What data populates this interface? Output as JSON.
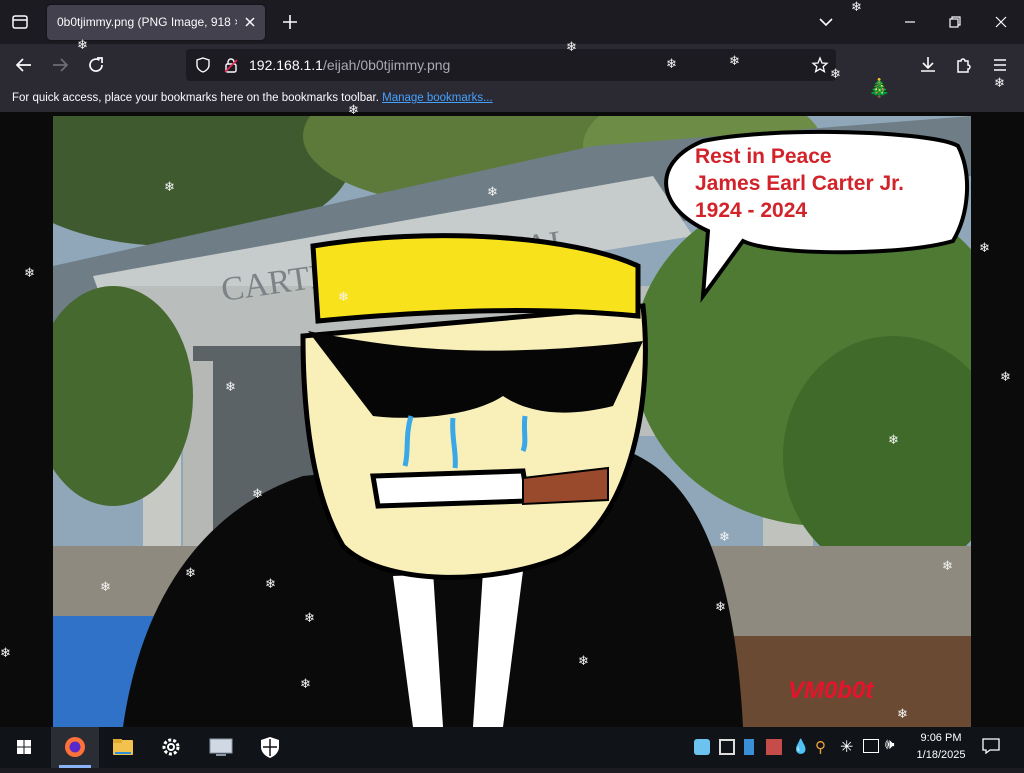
{
  "browser": {
    "tab_title": "0b0tjimmy.png (PNG Image, 918 ×",
    "url_host": "192.168.1.1",
    "url_path": "/eijah/0b0tjimmy.png",
    "bookmarks_message": "For quick access, place your bookmarks here on the bookmarks toolbar.",
    "bookmarks_link": "Manage bookmarks...",
    "icons": [
      "tab-list-icon",
      "new-tab-icon",
      "list-all-tabs-icon",
      "minimize-icon",
      "maximize-icon",
      "close-icon",
      "back-icon",
      "forward-icon",
      "reload-icon",
      "shield-icon",
      "lock-icon",
      "star-icon",
      "download-icon",
      "extensions-icon",
      "menu-icon"
    ]
  },
  "image": {
    "speech_line1": "Rest in Peace",
    "speech_line2": "James Earl Carter Jr.",
    "speech_line3": "1924 - 2024",
    "building_sign": "CARTER CENTENTIAL",
    "signature": "VM0b0t"
  },
  "taskbar": {
    "time": "9:06 PM",
    "date": "1/18/2025",
    "apps": [
      "start-icon",
      "firefox-icon",
      "file-explorer-icon",
      "settings-icon",
      "remote-desktop-icon",
      "windows-security-icon"
    ],
    "tray_icons": [
      "tray-app-icon",
      "tray-screen-icon",
      "tray-phone-icon",
      "tray-store-icon",
      "tray-drop-icon",
      "tray-search-icon",
      "tray-snowflake-icon",
      "tray-network-icon",
      "tray-volume-icon",
      "notifications-icon"
    ]
  },
  "colors": {
    "tab_bg": "#42414d",
    "toolbar_bg": "#2b2a33",
    "link": "#45a1ff",
    "speech_text": "#d2232a",
    "hat": "#f8e21c",
    "skin": "#f8f0b8",
    "signature": "#e8132a"
  }
}
